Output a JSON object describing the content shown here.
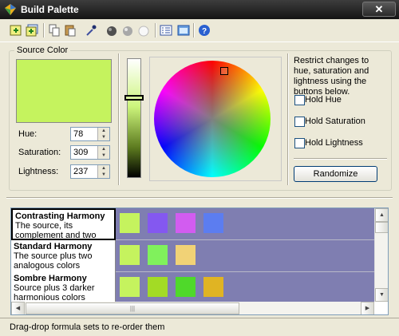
{
  "window": {
    "title": "Build Palette",
    "close_label": "✕"
  },
  "toolbar": {
    "icons": [
      "add-formula-icon",
      "add-multiple-icon",
      "copy-icon",
      "paste-icon",
      "eyedropper-icon",
      "dark-sphere-icon",
      "medium-sphere-icon",
      "light-sphere-icon",
      "list-view-icon",
      "preview-icon",
      "help-icon"
    ]
  },
  "source": {
    "group_label": "Source Color",
    "color": "#c5f35e",
    "hue_label": "Hue:",
    "hue_value": "78",
    "saturation_label": "Saturation:",
    "saturation_value": "309",
    "lightness_label": "Lightness:",
    "lightness_value": "237"
  },
  "restrict": {
    "text": "Restrict changes to hue, saturation and lightness using the buttons below.",
    "hold_hue": "Hold Hue",
    "hold_saturation": "Hold Saturation",
    "hold_lightness": "Hold Lightness",
    "randomize": "Randomize"
  },
  "harmonies": [
    {
      "name": "Contrasting Harmony",
      "desc": "The source, its complement and two analogous colors",
      "colors": [
        "#c5f35e",
        "#8458f0",
        "#d25cf0",
        "#5c7df0"
      ]
    },
    {
      "name": "Standard Harmony",
      "desc": "The source plus two analogous colors",
      "colors": [
        "#c5f35e",
        "#80f15c",
        "#f1d276"
      ]
    },
    {
      "name": "Sombre Harmony",
      "desc": "Source plus 3 darker harmonious colors",
      "colors": [
        "#c5f35e",
        "#a3db25",
        "#4fd92a",
        "#e0b423"
      ]
    }
  ],
  "status": {
    "text": "Drag-drop formula sets to re-order them"
  }
}
